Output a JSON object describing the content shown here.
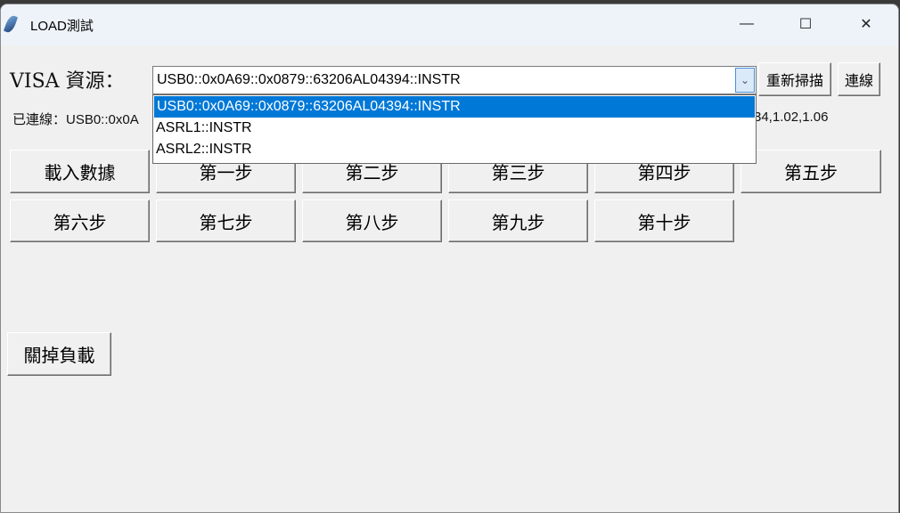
{
  "window": {
    "title": "LOAD測試",
    "minimize": "—",
    "maximize": "☐",
    "close": "✕"
  },
  "visa": {
    "label": "VISA 資源：",
    "selected": "USB0::0x0A69::0x0879::63206AL04394::INSTR",
    "options": [
      "USB0::0x0A69::0x0879::63206AL04394::INSTR",
      "ASRL1::INSTR",
      "ASRL2::INSTR"
    ],
    "rescan": "重新掃描",
    "connect": "連線"
  },
  "status": {
    "left": "已連線：USB0::0x0A",
    "right": "34,1.02,1.06"
  },
  "steps": [
    "載入數據",
    "第一步",
    "第二步",
    "第三步",
    "第四步",
    "第五步",
    "第六步",
    "第七步",
    "第八步",
    "第九步",
    "第十步"
  ],
  "load_off": "關掉負載"
}
